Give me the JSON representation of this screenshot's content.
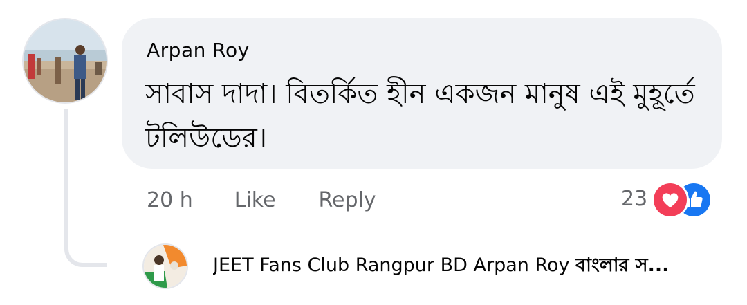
{
  "comment": {
    "author": "Arpan Roy",
    "text": "সাবাস দাদা। বিতর্কিত হীন একজন মানুষ এই মুহূর্তে টলিউডের।",
    "timestamp": "20 h",
    "like_label": "Like",
    "reply_label": "Reply",
    "reaction_count": "23",
    "reactions": [
      "love-icon",
      "like-icon"
    ]
  },
  "reply_preview": {
    "author": "JEET Fans Club Rangpur BD",
    "mention": "Arpan Roy",
    "snippet": "বাংলার স..."
  },
  "colors": {
    "bubble": "#f0f2f5",
    "muted_text": "#65676b",
    "like_blue": "#1877f2",
    "love_red": "#f33e58"
  }
}
